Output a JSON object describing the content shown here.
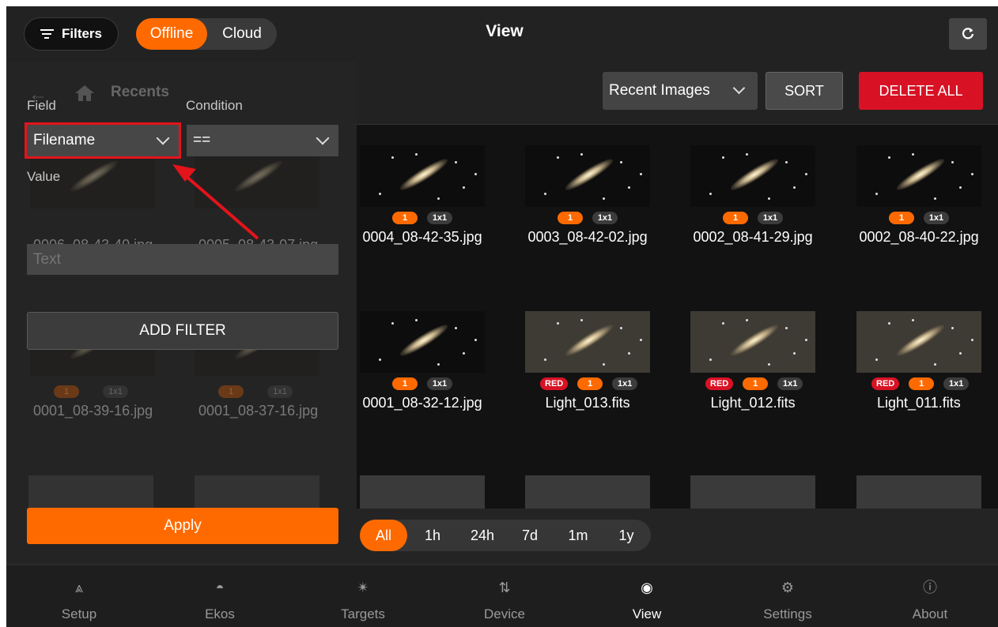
{
  "header": {
    "filters_label": "Filters",
    "segments": [
      "Offline",
      "Cloud"
    ],
    "active_segment": "Offline",
    "title": "View",
    "refresh_icon": "refresh-icon"
  },
  "filter_panel": {
    "behind": {
      "recents_label": "Recents",
      "files": [
        "0006_08-43-40.jpg",
        "0005_08-43-07.jpg",
        "0001_08-39-16.jpg",
        "0001_08-37-16.jpg"
      ]
    },
    "field_label": "Field",
    "field_value": "Filename",
    "condition_label": "Condition",
    "condition_value": "==",
    "value_label": "Value",
    "value_placeholder": "Text",
    "add_filter": "ADD FILTER",
    "apply": "Apply"
  },
  "toolbar": {
    "dropdown": "Recent Images",
    "sort": "SORT",
    "delete_all": "DELETE ALL"
  },
  "images": [
    {
      "name": "0004_08-42-35.jpg",
      "badges": [
        "1",
        "1x1"
      ]
    },
    {
      "name": "0003_08-42-02.jpg",
      "badges": [
        "1",
        "1x1"
      ]
    },
    {
      "name": "0002_08-41-29.jpg",
      "badges": [
        "1",
        "1x1"
      ]
    },
    {
      "name": "0002_08-40-22.jpg",
      "badges": [
        "1",
        "1x1"
      ]
    },
    {
      "name": "0001_08-32-12.jpg",
      "badges": [
        "1",
        "1x1"
      ]
    },
    {
      "name": "Light_013.fits",
      "badges": [
        "RED",
        "1",
        "1x1"
      ]
    },
    {
      "name": "Light_012.fits",
      "badges": [
        "RED",
        "1",
        "1x1"
      ]
    },
    {
      "name": "Light_011.fits",
      "badges": [
        "RED",
        "1",
        "1x1"
      ]
    }
  ],
  "time_ranges": [
    "All",
    "1h",
    "24h",
    "7d",
    "1m",
    "1y"
  ],
  "active_time_range": "All",
  "nav": [
    {
      "label": "Setup",
      "icon": "setup-icon"
    },
    {
      "label": "Ekos",
      "icon": "ekos-icon"
    },
    {
      "label": "Targets",
      "icon": "targets-icon"
    },
    {
      "label": "Device",
      "icon": "device-icon"
    },
    {
      "label": "View",
      "icon": "eye-icon"
    },
    {
      "label": "Settings",
      "icon": "gear-icon"
    },
    {
      "label": "About",
      "icon": "info-icon"
    }
  ],
  "active_nav": "View",
  "colors": {
    "accent": "#ff6a00",
    "danger": "#d81224",
    "highlight": "#e3141a"
  }
}
